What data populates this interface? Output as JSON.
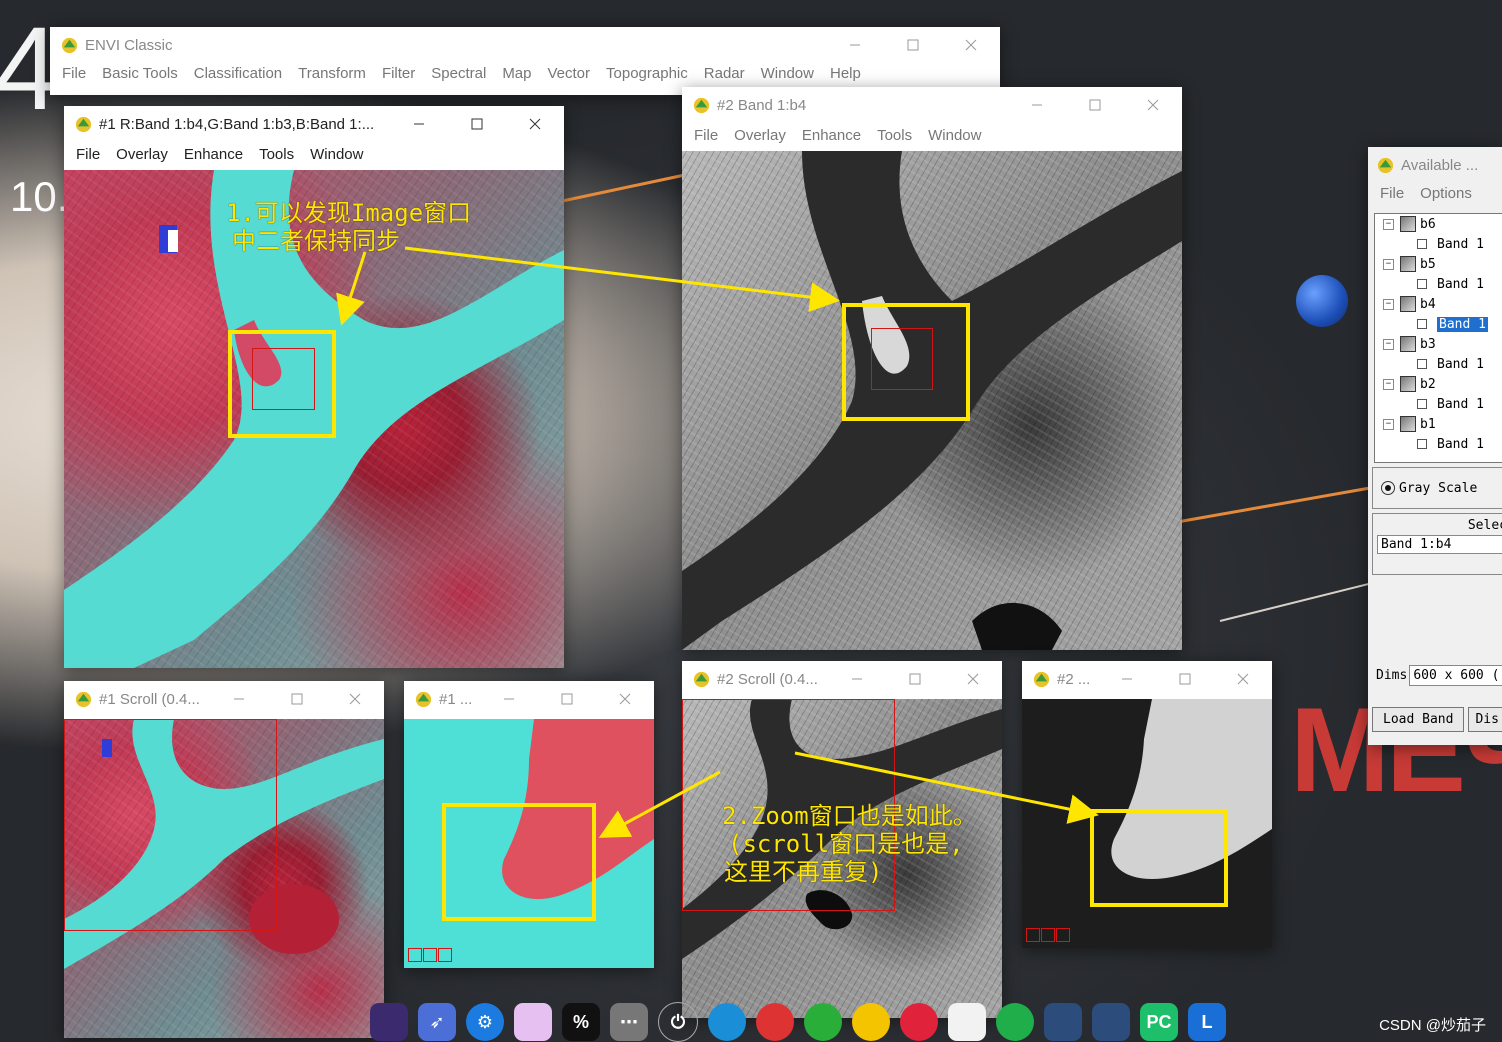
{
  "desktop": {
    "clock_text": "4",
    "date_text": "10.",
    "russian_text": "МЕЧТ",
    "watermark": "CSDN @炒茄子"
  },
  "envi_main": {
    "title": "ENVI Classic",
    "menu": [
      "File",
      "Basic Tools",
      "Classification",
      "Transform",
      "Filter",
      "Spectral",
      "Map",
      "Vector",
      "Topographic",
      "Radar",
      "Window",
      "Help"
    ]
  },
  "image1": {
    "title": "#1 R:Band 1:b4,G:Band 1:b3,B:Band 1:...",
    "menu": [
      "File",
      "Overlay",
      "Enhance",
      "Tools",
      "Window"
    ],
    "annotation_line1": "1.可以发现Image窗口",
    "annotation_line2": "中二者保持同步"
  },
  "image2": {
    "title": "#2 Band 1:b4",
    "menu": [
      "File",
      "Overlay",
      "Enhance",
      "Tools",
      "Window"
    ]
  },
  "scroll1": {
    "title": "#1 Scroll (0.4..."
  },
  "zoom1": {
    "title": "#1 ..."
  },
  "scroll2": {
    "title": "#2 Scroll (0.4...",
    "annotation_line1": "2.Zoom窗口也是如此。",
    "annotation_line2": "(scroll窗口是也是,",
    "annotation_line3": "这里不再重复)"
  },
  "zoom2": {
    "title": "#2 ..."
  },
  "available": {
    "title": "Available ...",
    "menu": [
      "File",
      "Options"
    ],
    "tree": [
      {
        "group": "b6",
        "band": "Band 1"
      },
      {
        "group": "b5",
        "band": "Band 1"
      },
      {
        "group": "b4",
        "band": "Band 1",
        "selected": true
      },
      {
        "group": "b3",
        "band": "Band 1"
      },
      {
        "group": "b2",
        "band": "Band 1"
      },
      {
        "group": "b1",
        "band": "Band 1"
      }
    ],
    "gray_scale": "Gray Scale",
    "selected_header": "Selec",
    "selected_band": "Band 1:b4",
    "dims_label": "Dims",
    "dims_value": "600 x 600 (",
    "load_band_button": "Load Band",
    "display_button": "Dis"
  },
  "colors": {
    "annotation": "#ffe600",
    "link_box": "#d21515",
    "selection": "#1e6fd0"
  },
  "taskbar": {
    "icons": [
      "rocket-icon",
      "settings-gear-icon",
      "folder-icon",
      "percent-app-icon",
      "more-icon",
      "power-icon",
      "edge-icon",
      "app-icon",
      "wechat-icon",
      "music-icon",
      "netease-icon",
      "baidu-cloud-icon",
      "green-app-icon",
      "envi-icon",
      "envi-icon-2",
      "pycharm-icon",
      "l-app-icon",
      "recycle-icon"
    ]
  }
}
